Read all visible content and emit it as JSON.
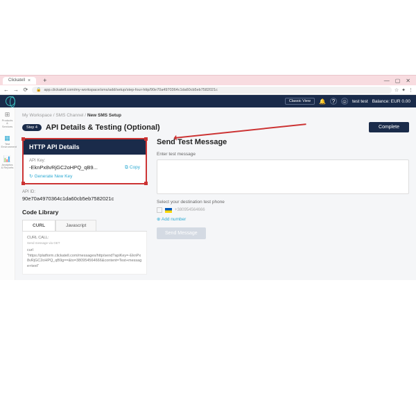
{
  "browser": {
    "tab_title": "Clickatell",
    "url": "app.clickatell.com/my-workspace/sms/add/setup/step-four-http/90e70a4970364c1da60cb5eb7582021c"
  },
  "window_controls": {
    "min": "—",
    "max": "▢",
    "close": "✕"
  },
  "header": {
    "classic_view": "Classic View",
    "user": "test test",
    "balance_label": "Balance: EUR 0.00"
  },
  "rail": {
    "products": "Products & Services",
    "test": "Test Environment",
    "analytics": "Analytics & Reports"
  },
  "breadcrumb": {
    "a": "My Workspace",
    "b": "SMS Channel",
    "c": "New SMS Setup",
    "sep": "/"
  },
  "step": {
    "pill": "Step 4",
    "title": "API Details & Testing (Optional)"
  },
  "complete_label": "Complete",
  "api": {
    "header": "HTTP API Details",
    "key_label": "API Key:",
    "key_value": "-EknPx8vRjGC2oHPQ_qB9...",
    "copy": "Copy",
    "generate": "Generate New Key",
    "id_label": "API ID:",
    "id_value": "90e70a4970364c1da60cb5eb7582021c"
  },
  "code_lib": {
    "title": "Code Library",
    "tab_curl": "CURL",
    "tab_js": "Javascript",
    "body_label": "CURL CALL:",
    "body_sub": "Send message via GET",
    "curl_cmd": "curl",
    "curl_url": "\"https://platform.clickatell.com/messages/http/send?apiKey=-EknPx8vRjGC2oHPQ_qB9g==&to=380954564666&content=Test+message+text\""
  },
  "send": {
    "title": "Send Test Message",
    "msg_label": "Enter test message",
    "dest_label": "Select your destination test phone",
    "phone_masked": "+380954564666",
    "add_number": "Add number",
    "send_btn": "Send Message",
    "add_icon": "⊕"
  },
  "icons": {
    "bell": "🔔",
    "help": "?",
    "user": "☺",
    "refresh": "↻",
    "copy": "⧉",
    "plus": "+",
    "back": "←",
    "fwd": "→",
    "reload": "⟳",
    "lock": "🔒",
    "star": "☆",
    "ext": "✦",
    "menu": "⋮",
    "grid": "▦",
    "boxes": "⊞",
    "chart": "📊"
  }
}
